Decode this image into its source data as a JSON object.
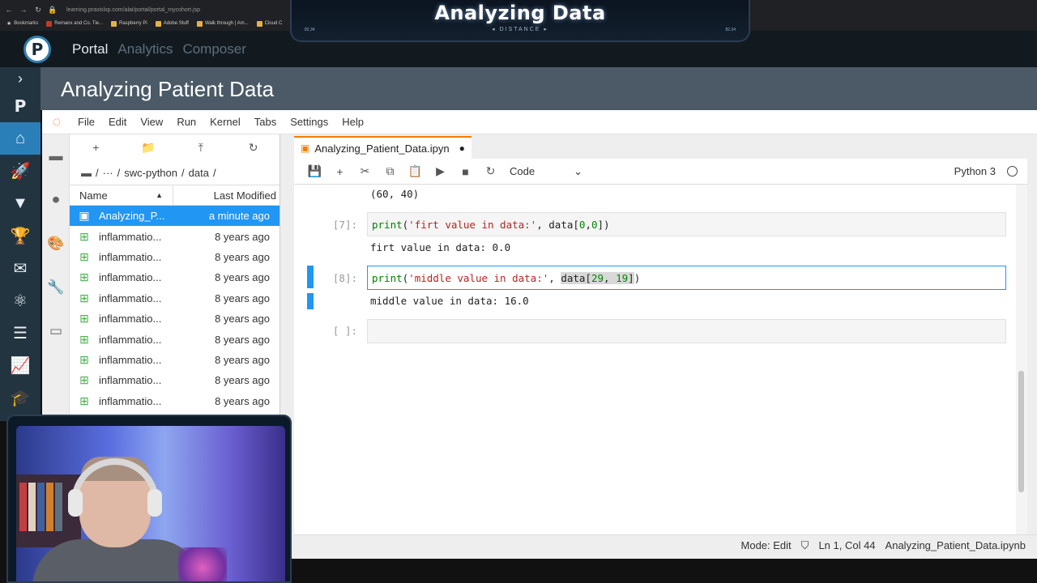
{
  "browser": {
    "url": "learning.praxislxp.com/alai/portal/portal_mycohort.jsp",
    "bookmarks": [
      "Bookmarks",
      "Remanx and Co. Tie...",
      "Raspberry Pi",
      "Adobe Stuff",
      "Walk through | Am...",
      "Cloud C"
    ]
  },
  "overlay": {
    "title": "Analyzing Data",
    "sub": "DISTANCE",
    "left_num": "82.34",
    "right_num": "82.34"
  },
  "portal": {
    "logo_letter": "P",
    "nav": [
      "Portal",
      "Analytics",
      "Composer"
    ],
    "active_nav": "Portal",
    "page_title": "Analyzing Patient Data",
    "rail_icons": [
      "chevron-right-icon",
      "p-logo-icon",
      "cohort-icon",
      "rocket-icon",
      "gitlab-icon",
      "trophy-icon",
      "mail-icon",
      "atom-icon",
      "server-icon",
      "chart-icon",
      "graduation-cap-icon"
    ]
  },
  "jupyter": {
    "menu": [
      "File",
      "Edit",
      "View",
      "Run",
      "Kernel",
      "Tabs",
      "Settings",
      "Help"
    ],
    "breadcrumb": [
      "/",
      "···",
      "/",
      "swc-python",
      "/",
      "data",
      "/"
    ],
    "columns": {
      "name": "Name",
      "modified": "Last Modified"
    },
    "files": [
      {
        "name": "Analyzing_P...",
        "modified": "a minute ago",
        "type": "notebook",
        "selected": true
      },
      {
        "name": "inflammatio...",
        "modified": "8 years ago",
        "type": "csv"
      },
      {
        "name": "inflammatio...",
        "modified": "8 years ago",
        "type": "csv"
      },
      {
        "name": "inflammatio...",
        "modified": "8 years ago",
        "type": "csv"
      },
      {
        "name": "inflammatio...",
        "modified": "8 years ago",
        "type": "csv"
      },
      {
        "name": "inflammatio...",
        "modified": "8 years ago",
        "type": "csv"
      },
      {
        "name": "inflammatio...",
        "modified": "8 years ago",
        "type": "csv"
      },
      {
        "name": "inflammatio...",
        "modified": "8 years ago",
        "type": "csv"
      },
      {
        "name": "inflammatio...",
        "modified": "8 years ago",
        "type": "csv"
      },
      {
        "name": "inflammatio...",
        "modified": "8 years ago",
        "type": "csv"
      }
    ],
    "tab_title": "Analyzing_Patient_Data.ipyn",
    "tab_dirty": "●",
    "cell_type": "Code",
    "kernel_name": "Python 3",
    "cells": {
      "output_prev": "(60, 40)",
      "c7_prompt": "[7]:",
      "c7_out": "firt value in data: 0.0",
      "c8_prompt": "[8]:",
      "c8_out": "middle value in data: 16.0",
      "empty_prompt": "[ ]:"
    },
    "status": {
      "mode": "Mode: Edit",
      "position": "Ln 1, Col 44",
      "file": "Analyzing_Patient_Data.ipynb"
    }
  },
  "colors": {
    "accent": "#2196f3",
    "portal_active": "#2b7fb8",
    "jupyter_orange": "#f57c00"
  }
}
